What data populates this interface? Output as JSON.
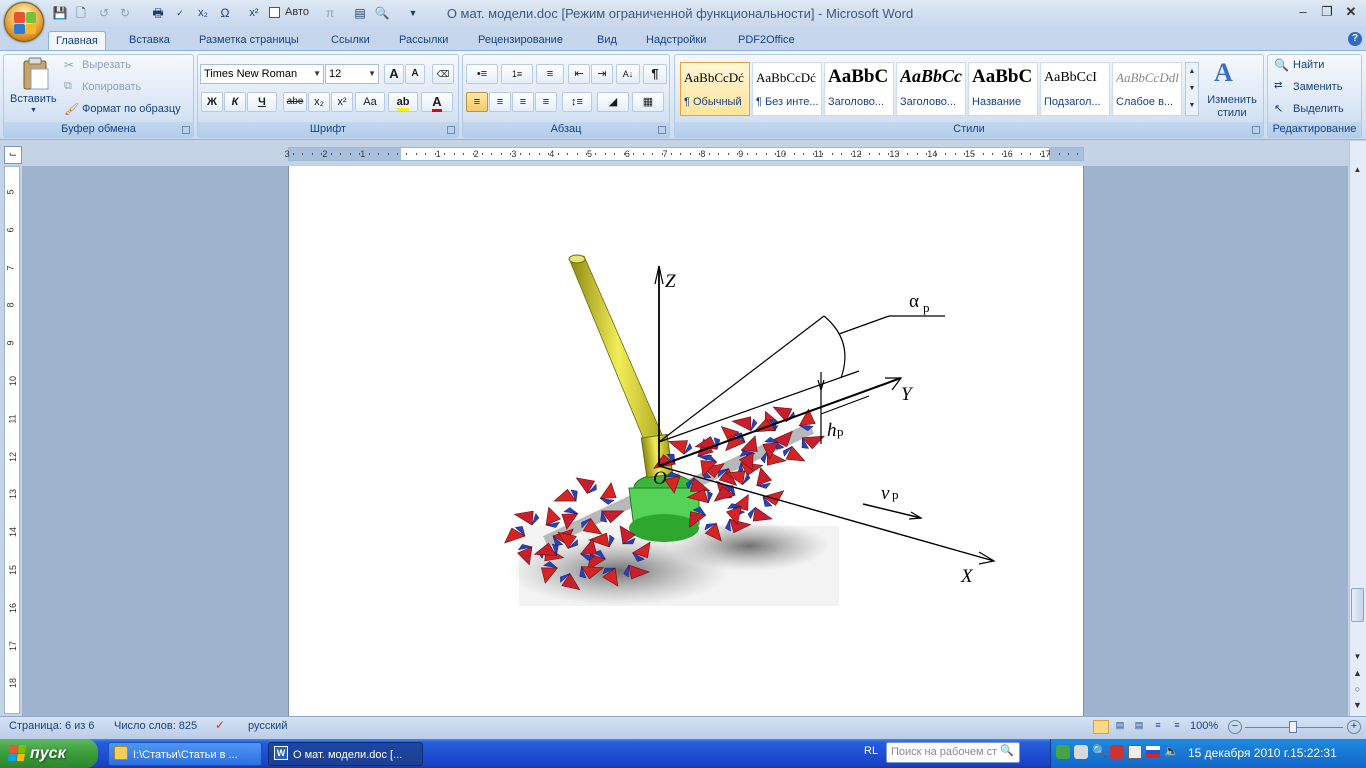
{
  "window": {
    "title": "О мат. модели.doc [Режим ограниченной функциональности] - Microsoft Word",
    "qat_auto_label": "Авто"
  },
  "tabs": [
    "Главная",
    "Вставка",
    "Разметка страницы",
    "Ссылки",
    "Рассылки",
    "Рецензирование",
    "Вид",
    "Надстройки",
    "PDF2Office"
  ],
  "clipboard": {
    "paste": "Вставить",
    "cut": "Вырезать",
    "copy": "Копировать",
    "format_painter": "Формат по образцу",
    "label": "Буфер обмена"
  },
  "font": {
    "name": "Times New Roman",
    "size": "12",
    "label": "Шрифт",
    "bold": "Ж",
    "italic": "К",
    "underline": "Ч",
    "strike": "abe",
    "subscript": "x₂",
    "superscript": "x²",
    "case": "Aa",
    "grow": "A",
    "shrink": "A"
  },
  "paragraph": {
    "label": "Абзац",
    "pilcrow": "¶"
  },
  "styles": {
    "label": "Стили",
    "items": [
      {
        "preview": "AaBbCcDć",
        "name": "¶ Обычный"
      },
      {
        "preview": "AaBbCcDć",
        "name": "¶ Без инте..."
      },
      {
        "preview": "AaBbC",
        "name": "Заголово..."
      },
      {
        "preview": "AaBbCc",
        "name": "Заголово..."
      },
      {
        "preview": "AaBbC",
        "name": "Название"
      },
      {
        "preview": "AaBbCcI",
        "name": "Подзагол..."
      },
      {
        "preview": "AaBbCcDdl",
        "name": "Слабое в..."
      }
    ],
    "change_styles": "Изменить стили"
  },
  "editing": {
    "label": "Редактирование",
    "find": "Найти",
    "replace": "Заменить",
    "select": "Выделить"
  },
  "ruler": {
    "h_ticks": [
      "3",
      "2",
      "1",
      "1",
      "2",
      "3",
      "4",
      "5",
      "6",
      "7",
      "8",
      "9",
      "10",
      "11",
      "12",
      "13",
      "14",
      "15",
      "16",
      "17"
    ],
    "v_ticks": [
      "5",
      "6",
      "7",
      "8",
      "9",
      "10",
      "11",
      "12",
      "13",
      "14",
      "15",
      "16",
      "17",
      "18"
    ]
  },
  "figure": {
    "axis_z": "Z",
    "axis_y": "Y",
    "axis_x": "X",
    "origin": "O",
    "alpha": "α",
    "alpha_sub": "p",
    "h": "h",
    "h_sub": "p",
    "v": "v",
    "v_sub": "p"
  },
  "status": {
    "page": "Страница: 6 из 6",
    "words": "Число слов: 825",
    "language": "русский",
    "zoom": "100%"
  },
  "taskbar": {
    "start": "пуск",
    "tasks": [
      "I:\\Статьи\\Статьи в ...",
      "О мат. модели.doc [..."
    ],
    "lang": "RL",
    "search_placeholder": "Поиск на рабочем ст",
    "clock": "15 декабря 2010 г.15:22:31"
  }
}
